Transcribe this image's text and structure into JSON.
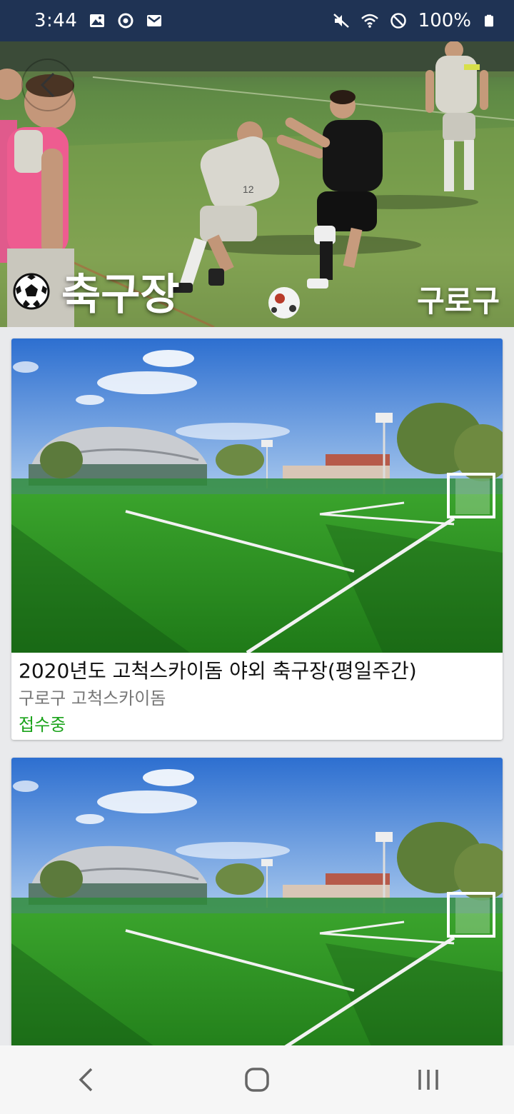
{
  "status_bar": {
    "time": "3:44",
    "battery": "100%",
    "left_icons": [
      "image-icon",
      "sync-icon",
      "mail-icon"
    ],
    "right_icons": [
      "mute-icon",
      "wifi-icon",
      "no-disturb-icon",
      "battery-icon"
    ]
  },
  "hero": {
    "title": "축구장",
    "district": "구로구",
    "icon": "soccer-ball-icon"
  },
  "cards": [
    {
      "title": "2020년도 고척스카이돔 야외 축구장(평일주간)",
      "subtitle": "구로구 고척스카이돔",
      "status": "접수중",
      "status_color": "#1aa31a"
    },
    {
      "title": "",
      "subtitle": "",
      "status": ""
    }
  ],
  "nav": {
    "buttons": [
      "back-icon",
      "home-icon",
      "recents-icon"
    ]
  },
  "colors": {
    "status_bar_bg": "#1f3354",
    "page_bg": "#e9eaec",
    "accent_green": "#1aa31a"
  }
}
